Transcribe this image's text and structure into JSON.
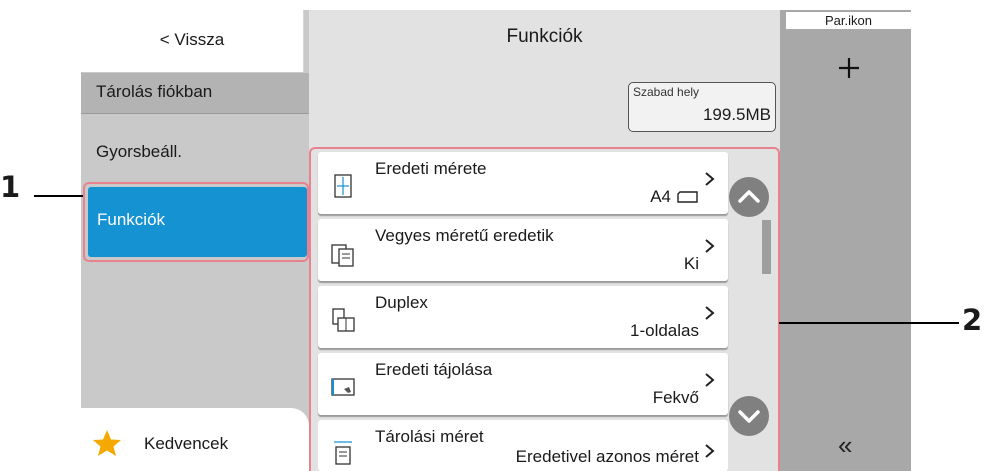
{
  "header": {
    "title": "Funkciók"
  },
  "nav": {
    "back_label": "< Vissza",
    "storage_label": "Tárolás fiókban",
    "quick_setup_label": "Gyorsbeáll.",
    "functions_label": "Funkciók",
    "favorites_label": "Kedvencek"
  },
  "free_space": {
    "label": "Szabad hely",
    "value": "199.5MB"
  },
  "functions": [
    {
      "name": "Eredeti mérete",
      "value": "A4",
      "icon": "original-size-icon"
    },
    {
      "name": "Vegyes méretű eredetik",
      "value": "Ki",
      "icon": "mixed-size-icon"
    },
    {
      "name": "Duplex",
      "value": "1-oldalas",
      "icon": "duplex-icon"
    },
    {
      "name": "Eredeti tájolása",
      "value": "Fekvő",
      "icon": "orientation-icon"
    },
    {
      "name": "Tárolási méret",
      "value": "Eredetivel azonos méret",
      "icon": "storage-size-icon"
    }
  ],
  "right_panel": {
    "par_icon_label": "Par.ikon",
    "add_symbol": "+",
    "collapse_symbol": "«"
  },
  "callouts": {
    "one": "1",
    "two": "2"
  },
  "colors": {
    "accent": "#1592d2",
    "highlight": "#e8828f",
    "star": "#f5a800"
  }
}
